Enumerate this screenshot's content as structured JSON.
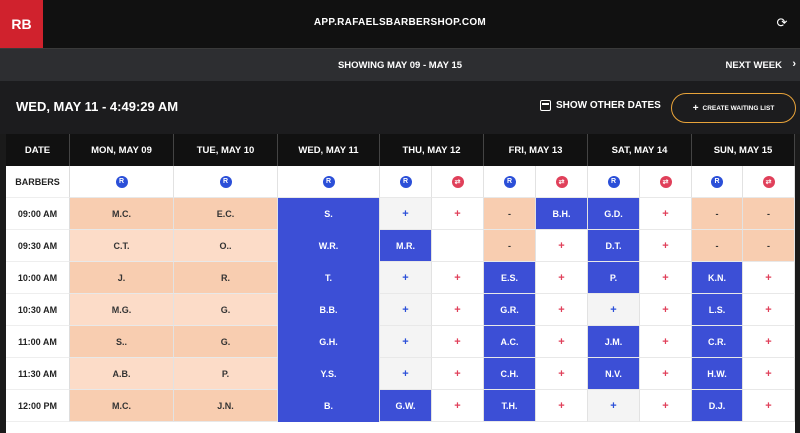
{
  "app": {
    "logo": "RB",
    "url": "APP.RAFAELSBARBERSHOP.COM"
  },
  "week": {
    "showing": "SHOWING MAY 09 - MAY 15",
    "next_label": "NEXT WEEK"
  },
  "current_datetime": "WED, MAY 11 - 4:49:29  AM",
  "show_other_dates": "SHOW OTHER DATES",
  "create_waiting_list": "CREATE WAITING LIST",
  "table": {
    "date_header": "DATE",
    "barbers_label": "BARBERS",
    "days": [
      {
        "label": "MON, MAY 09"
      },
      {
        "label": "TUE, MAY 10"
      },
      {
        "label": "WED, MAY 11"
      },
      {
        "label": "THU, MAY 12"
      },
      {
        "label": "FRI, MAY 13"
      },
      {
        "label": "SAT, MAY 14"
      },
      {
        "label": "SUN, MAY 15"
      }
    ],
    "times": [
      "09:00 AM",
      "09:30 AM",
      "10:00 AM",
      "10:30 AM",
      "11:00 AM",
      "11:30 AM",
      "12:00 PM"
    ],
    "mon": [
      "M.C.",
      "C.T.",
      "J.",
      "M.G.",
      "S..",
      "A.B.",
      "M.C."
    ],
    "tue": [
      "E.C.",
      "O..",
      "R.",
      "G.",
      "G.",
      "P.",
      "J.N."
    ],
    "wed": [
      "S.",
      "W.R.",
      "T.",
      "B.B.",
      "G.H.",
      "Y.S.",
      "B."
    ],
    "thu_r": [
      "+",
      "M.R.",
      "+",
      "+",
      "+",
      "+",
      "G.W."
    ],
    "thu_w": [
      "+",
      "",
      "+",
      "+",
      "+",
      "+",
      "+"
    ],
    "fri_r": [
      "-",
      "-",
      "E.S.",
      "G.R.",
      "A.C.",
      "C.H.",
      "T.H."
    ],
    "fri_w": [
      "B.H.",
      "+",
      "+",
      "+",
      "+",
      "+",
      "+"
    ],
    "sat_r": [
      "G.D.",
      "D.T.",
      "P.",
      "+",
      "J.M.",
      "N.V.",
      "+"
    ],
    "sat_w": [
      "+",
      "+",
      "+",
      "+",
      "+",
      "+",
      "+"
    ],
    "sun_r": [
      "-",
      "-",
      "K.N.",
      "L.S.",
      "C.R.",
      "H.W.",
      "D.J."
    ],
    "sun_w": [
      "-",
      "-",
      "+",
      "+",
      "+",
      "+",
      "+"
    ],
    "badge_r": "R",
    "badge_w": "⇄"
  },
  "colors": {
    "peach": "#f8cdb0",
    "peach_light": "#fcdcc8",
    "booked_blue": "#3c4fd6",
    "white": "#ffffff",
    "gray": "#f4f4f4"
  }
}
